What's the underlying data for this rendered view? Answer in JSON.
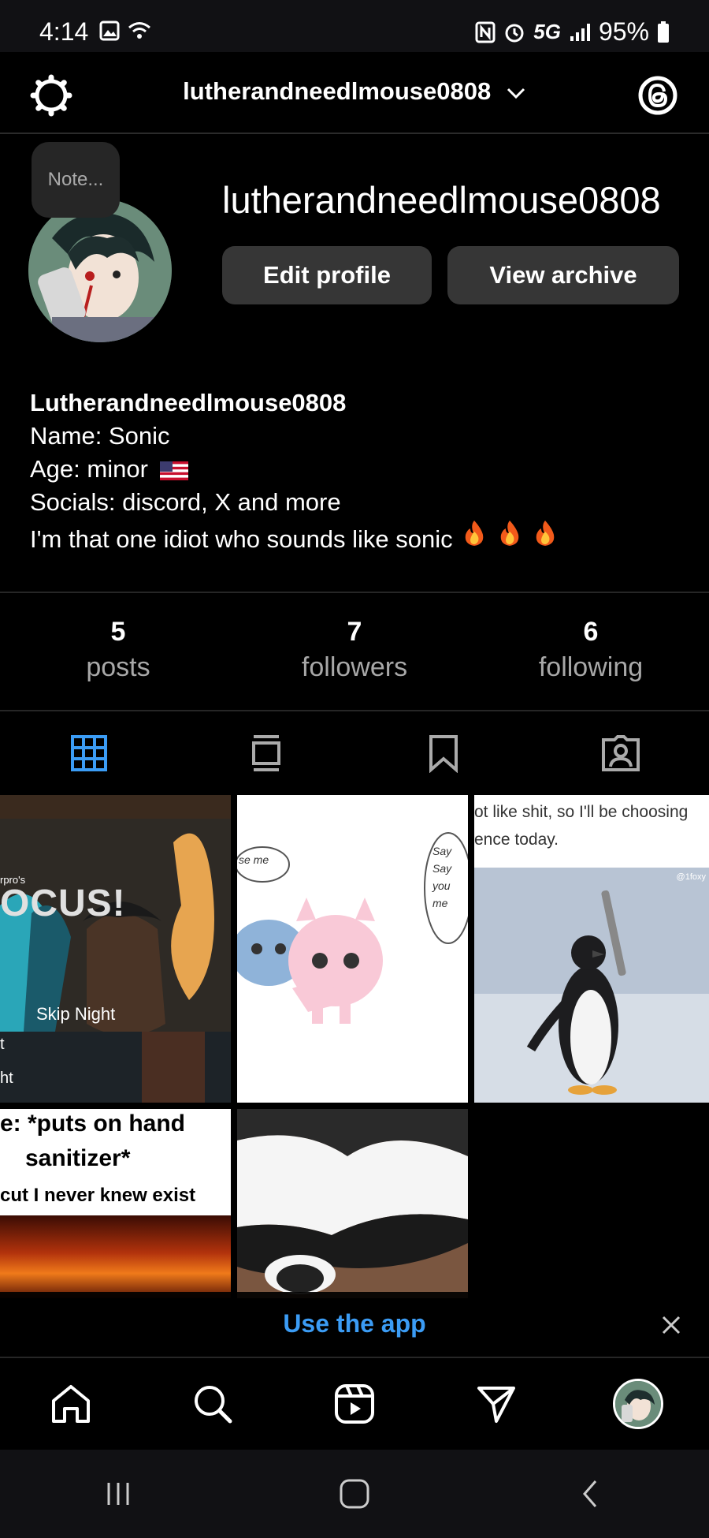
{
  "status_bar": {
    "time": "4:14",
    "network": "5G",
    "battery": "95%"
  },
  "header": {
    "username": "lutherandneedlmouse0808"
  },
  "profile": {
    "note_placeholder": "Note...",
    "display_username": "lutherandneedlmouse0808",
    "edit_button": "Edit profile",
    "archive_button": "View archive"
  },
  "bio": {
    "name_line": "Lutherandneedlmouse0808",
    "line1": "Name: Sonic",
    "line2": "Age: minor",
    "line3": "Socials: discord, X and more",
    "line4": "I'm that one idiot who sounds like sonic"
  },
  "stats": [
    {
      "value": "5",
      "label": "posts"
    },
    {
      "value": "7",
      "label": "followers"
    },
    {
      "value": "6",
      "label": "following"
    }
  ],
  "posts": {
    "p1_caption_top": "rpro's",
    "p1_big": "OCUS!",
    "p1_caption": "Skip Night",
    "p1_frag1": "t",
    "p1_frag2": "ht",
    "p2_left_bubble": "se me",
    "p2_right_bubble": "Say Say you me",
    "p3_line1": "ot like shit, so I'll be choosing",
    "p3_line2": "ence today.",
    "p3_credit": "@1foxy",
    "p4_line1": "e: *puts on hand",
    "p4_line2": "sanitizer*",
    "p4_line3": "cut I never knew exist"
  },
  "banner": {
    "text": "Use the app"
  },
  "colors": {
    "accent_blue": "#3b9cf5",
    "button_bg": "#363636"
  }
}
